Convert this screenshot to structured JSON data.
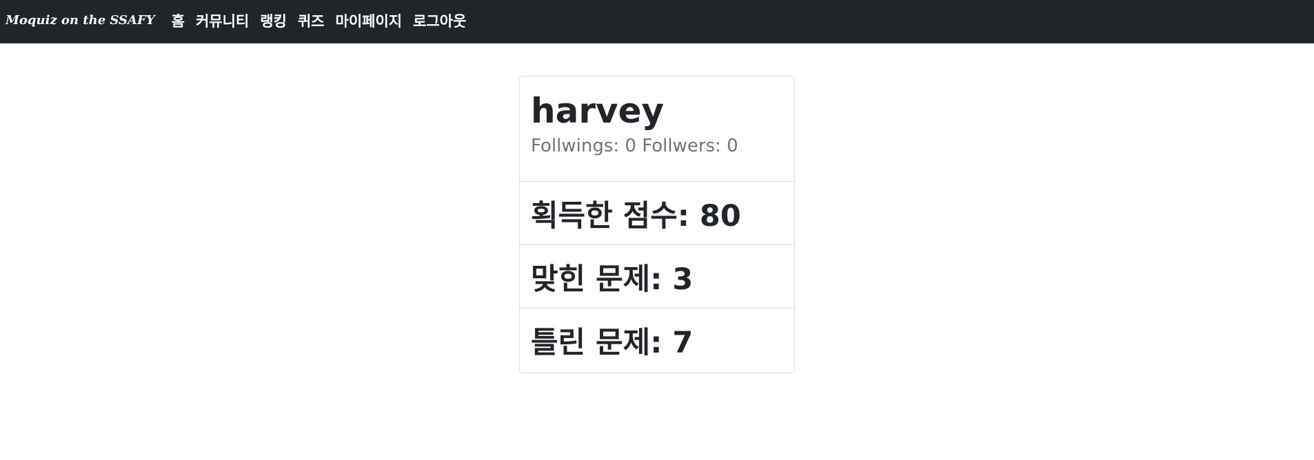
{
  "navbar": {
    "brand": "Moquiz on the SSAFY",
    "links": [
      "홈",
      "커뮤니티",
      "랭킹",
      "퀴즈",
      "마이페이지",
      "로그아웃"
    ]
  },
  "profile": {
    "username": "harvey",
    "follow_text": "Follwings: 0 Follwers: 0",
    "stats": [
      "획득한 점수: 80",
      "맞힌 문제: 3",
      "틀린 문제: 7"
    ]
  },
  "colors": {
    "navbar_bg": "#212529",
    "text_dark": "#212529",
    "text_muted": "#6c757d",
    "border": "#dcdcdc"
  }
}
